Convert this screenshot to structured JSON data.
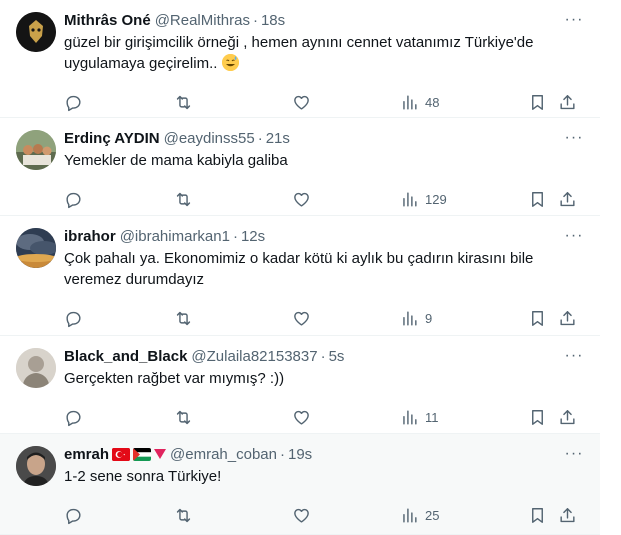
{
  "tweets": [
    {
      "name": "Mithrâs Oné",
      "handle": "@RealMithras",
      "time": "18s",
      "lines": [
        "güzel bir girişimcilik örneği , hemen aynını cennet vatanımız Türkiye'de",
        "uygulamaya geçirelim.. "
      ],
      "views": "48",
      "avatar_color": "#1b1b1b",
      "emoji": "sweat-smile"
    },
    {
      "name": "Erdinç AYDIN",
      "handle": "@eaydinss55",
      "time": "21s",
      "lines": [
        "Yemekler de mama kabiyla galiba"
      ],
      "views": "129",
      "avatar_color": "#7a8d6a"
    },
    {
      "name": "ibrahor",
      "handle": "@ibrahimarkan1",
      "time": "12s",
      "lines": [
        "Çok pahalı ya. Ekonomimiz o kadar kötü ki aylık bu çadırın kirasını bile",
        "veremez durumdayız"
      ],
      "views": "9",
      "avatar_color": "#3d4a5c"
    },
    {
      "name": "Black_and_Black",
      "handle": "@Zulaila82153837",
      "time": "5s",
      "lines": [
        "Gerçekten rağbet var mıymış? :))"
      ],
      "views": "11",
      "avatar_color": "#cfcac2"
    },
    {
      "name": "emrah",
      "handle": "@emrah_coban",
      "time": "19s",
      "lines": [
        "1-2 sene sonra Türkiye!"
      ],
      "views": "25",
      "avatar_color": "#3a3a3a",
      "name_flags": [
        "turkey-flag",
        "palestine-flag",
        "red-triangle"
      ]
    }
  ],
  "dot": "·",
  "more_glyph": "···",
  "colors": {
    "text": "#0f1419",
    "secondary": "#536471",
    "border": "#eff3f4",
    "highlight_bg": "#f7f9f9"
  }
}
